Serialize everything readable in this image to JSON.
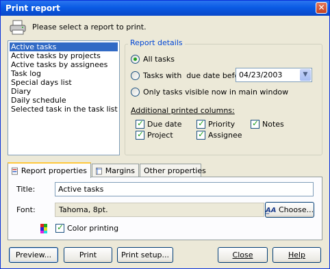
{
  "window": {
    "title": "Print report"
  },
  "prompt": "Please select a report to print.",
  "reports": [
    "Active tasks",
    "Active tasks by projects",
    "Active tasks by assignees",
    "Task log",
    "Special days list",
    "Diary",
    "Daily schedule",
    "Selected task in the task list"
  ],
  "details": {
    "legend": "Report details",
    "radio_all": "All tasks",
    "radio_due": "Tasks with  due date before",
    "due_date": "04/23/2003",
    "radio_visible": "Only tasks visible now in main window",
    "columns_label": "Additional printed columns:",
    "col_due": "Due date",
    "col_priority": "Priority",
    "col_notes": "Notes",
    "col_project": "Project",
    "col_assignee": "Assignee"
  },
  "tabs": {
    "report_props": "Report properties",
    "margins": "Margins",
    "other_props": "Other properties"
  },
  "props": {
    "title_label": "Title:",
    "title_value": "Active tasks",
    "font_label": "Font:",
    "font_value": "Tahoma, 8pt.",
    "choose_label": "Choose...",
    "color_printing": "Color printing"
  },
  "buttons": {
    "preview": "Preview...",
    "print": "Print",
    "print_setup": "Print setup...",
    "close": "Close",
    "help": "Help"
  },
  "colors": {
    "selection": "#316ac5",
    "title_bar": "#0a5be4",
    "legend": "#0046d5"
  }
}
